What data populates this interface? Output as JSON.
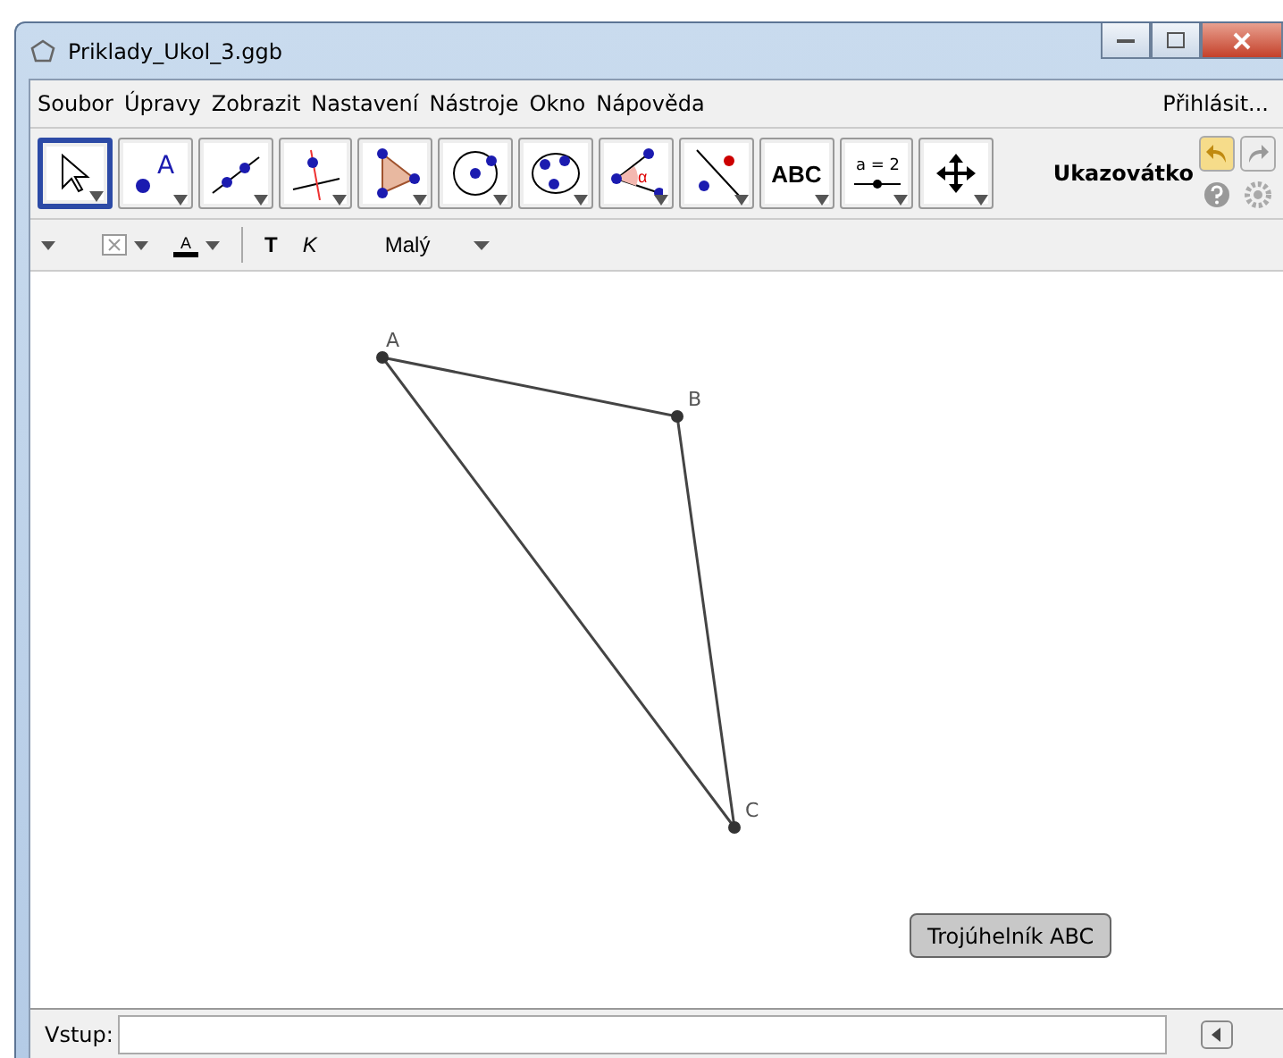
{
  "window": {
    "title": "Priklady_Ukol_3.ggb"
  },
  "menu": [
    "Soubor",
    "Úpravy",
    "Zobrazit",
    "Nastavení",
    "Nástroje",
    "Okno",
    "Nápověda"
  ],
  "login": "Přihlásit...",
  "tools": [
    {
      "kind": "move",
      "selected": true
    },
    {
      "kind": "point",
      "selected": false,
      "label": "A"
    },
    {
      "kind": "line",
      "selected": false
    },
    {
      "kind": "perpendicular",
      "selected": false
    },
    {
      "kind": "polygon",
      "selected": false
    },
    {
      "kind": "circle",
      "selected": false
    },
    {
      "kind": "conic",
      "selected": false
    },
    {
      "kind": "angle",
      "selected": false,
      "label": "α"
    },
    {
      "kind": "reflect",
      "selected": false
    },
    {
      "kind": "text",
      "selected": false,
      "label": "ABC"
    },
    {
      "kind": "slider",
      "selected": false,
      "label": "a = 2"
    },
    {
      "kind": "pan",
      "selected": false
    }
  ],
  "tool_name": "Ukazovátko",
  "style_bar": {
    "color_label": "A",
    "bold": "T",
    "italic": "K",
    "size": "Malý"
  },
  "points": [
    {
      "label": "A"
    },
    {
      "label": "B"
    },
    {
      "label": "C"
    }
  ],
  "canvas_button": "Trojúhelník ABC",
  "input_bar": {
    "label": "Vstup:"
  }
}
